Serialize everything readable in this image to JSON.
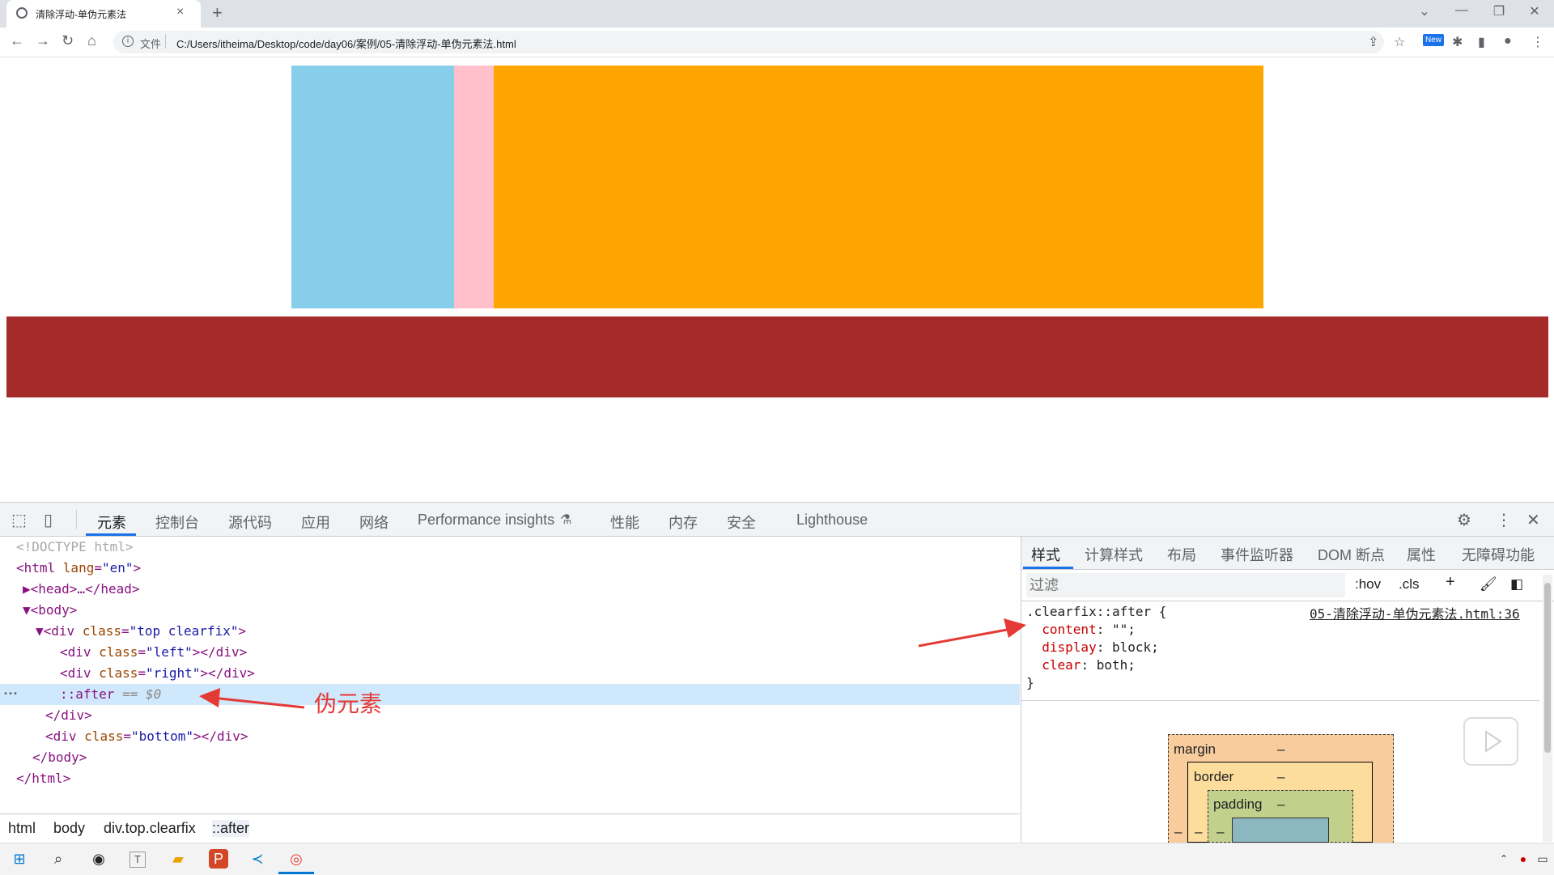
{
  "browser": {
    "tab_title": "清除浮动-单伪元素法",
    "tab_close": "×",
    "new_tab": "+",
    "file_label": "文件",
    "url": "C:/Users/itheima/Desktop/code/day06/案例/05-清除浮动-单伪元素法.html",
    "window_buttons": [
      "⌄",
      "—",
      "❐",
      "✕"
    ]
  },
  "page": {
    "colors": {
      "left": "#87ceeb",
      "pink": "#ffc0cb",
      "right": "#ffa500",
      "bottom": "#a52a2a"
    }
  },
  "devtools": {
    "tabs": [
      "元素",
      "控制台",
      "源代码",
      "应用",
      "网络",
      "Performance insights",
      "性能",
      "内存",
      "安全",
      "Lighthouse"
    ],
    "dom_lines": [
      {
        "parts": [
          [
            "doctype",
            "<!DOCTYPE html>"
          ]
        ]
      },
      {
        "parts": [
          [
            "tag",
            "<html "
          ],
          [
            "attr",
            "lang"
          ],
          [
            "tag",
            "="
          ],
          [
            "val",
            "\"en\""
          ],
          [
            "tag",
            ">"
          ]
        ]
      },
      {
        "parts": [
          [
            "tag",
            "▶<head>…</head>"
          ]
        ]
      },
      {
        "parts": [
          [
            "tag",
            "▼<body>"
          ]
        ]
      },
      {
        "parts": [
          [
            "tag",
            "▼<div "
          ],
          [
            "attr",
            "class"
          ],
          [
            "tag",
            "="
          ],
          [
            "val",
            "\"top clearfix\""
          ],
          [
            "tag",
            ">"
          ]
        ]
      },
      {
        "parts": [
          [
            "tag",
            "<div "
          ],
          [
            "attr",
            "class"
          ],
          [
            "tag",
            "="
          ],
          [
            "val",
            "\"left\""
          ],
          [
            "tag",
            "></div>"
          ]
        ]
      },
      {
        "parts": [
          [
            "tag",
            "<div "
          ],
          [
            "attr",
            "class"
          ],
          [
            "tag",
            "="
          ],
          [
            "val",
            "\"right\""
          ],
          [
            "tag",
            "></div>"
          ]
        ]
      },
      {
        "parts": [
          [
            "pseudo",
            "::after"
          ],
          [
            "dollar",
            " == $0"
          ]
        ]
      },
      {
        "parts": [
          [
            "tag",
            "</div>"
          ]
        ]
      },
      {
        "parts": [
          [
            "tag",
            "<div "
          ],
          [
            "attr",
            "class"
          ],
          [
            "tag",
            "="
          ],
          [
            "val",
            "\"bottom\""
          ],
          [
            "tag",
            "></div>"
          ]
        ]
      },
      {
        "parts": [
          [
            "tag",
            "</body>"
          ]
        ]
      },
      {
        "parts": [
          [
            "tag",
            "</html>"
          ]
        ]
      }
    ],
    "breadcrumb": [
      "html",
      "body",
      "div.top.clearfix",
      "::after"
    ],
    "styles_tabs": [
      "样式",
      "计算样式",
      "布局",
      "事件监听器",
      "DOM 断点",
      "属性",
      "无障碍功能"
    ],
    "filter_placeholder": "过滤",
    "filter_buttons": [
      ":hov",
      ".cls",
      "+"
    ],
    "rule": {
      "selector": ".clearfix::after {",
      "declarations": [
        {
          "prop": "content",
          "value": "\"\";"
        },
        {
          "prop": "display",
          "value": "block;"
        },
        {
          "prop": "clear",
          "value": "both;"
        }
      ],
      "close": "}",
      "source": "05-清除浮动-单伪元素法.html:36"
    },
    "box_model": {
      "margin_label": "margin",
      "border_label": "border",
      "padding_label": "padding",
      "dash": "–"
    }
  },
  "annotation": {
    "label": "伪元素"
  }
}
